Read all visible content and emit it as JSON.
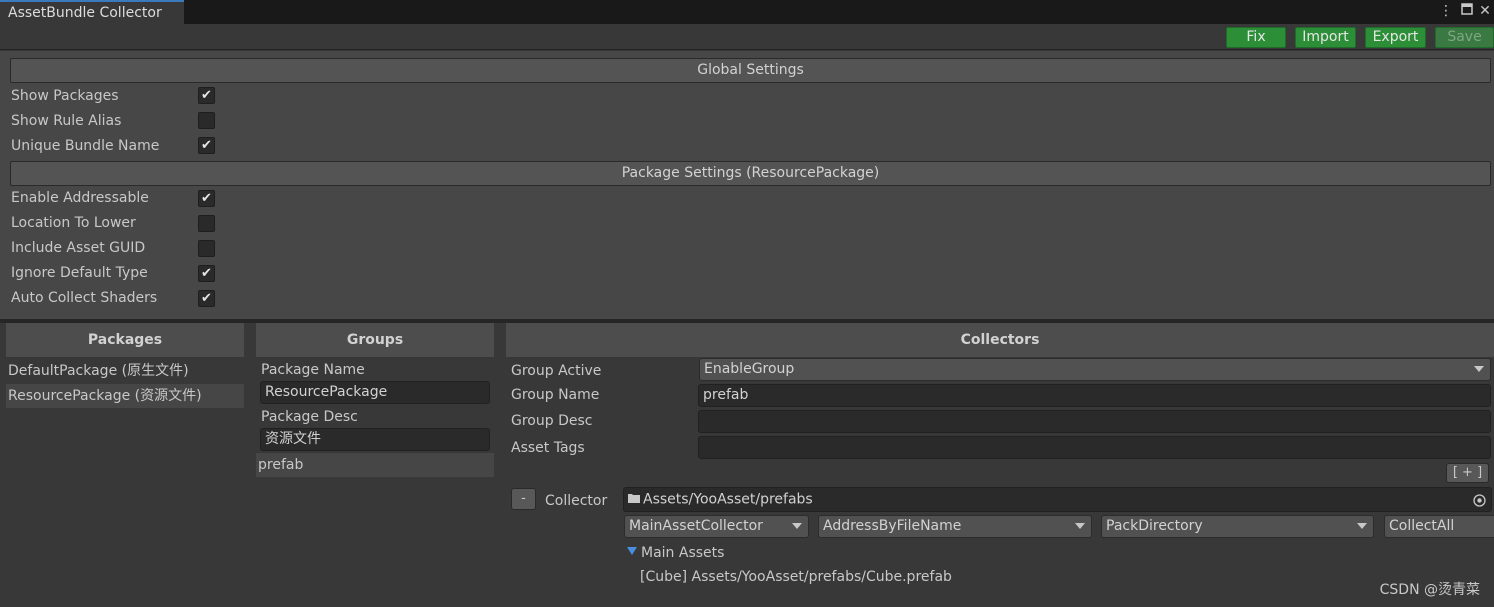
{
  "window": {
    "tab_title": "AssetBundle Collector",
    "menu_icon": "kebab-menu-icon",
    "maximize_icon": "maximize-icon",
    "close_icon": "close-icon"
  },
  "toolbar": {
    "fix": "Fix",
    "import": "Import",
    "export": "Export",
    "save": "Save"
  },
  "global_settings": {
    "header": "Global Settings",
    "options": [
      {
        "label": "Show Packages",
        "checked": true
      },
      {
        "label": "Show Rule Alias",
        "checked": false
      },
      {
        "label": "Unique Bundle Name",
        "checked": true
      }
    ]
  },
  "package_settings": {
    "header": "Package Settings (ResourcePackage)",
    "options": [
      {
        "label": "Enable Addressable",
        "checked": true
      },
      {
        "label": "Location To Lower",
        "checked": false
      },
      {
        "label": "Include Asset GUID",
        "checked": false
      },
      {
        "label": "Ignore Default Type",
        "checked": true
      },
      {
        "label": "Auto Collect Shaders",
        "checked": true
      }
    ]
  },
  "packages": {
    "header": "Packages",
    "items": [
      {
        "label": "DefaultPackage (原生文件)"
      },
      {
        "label": "ResourcePackage (资源文件)"
      }
    ]
  },
  "groups": {
    "header": "Groups",
    "package_name_label": "Package Name",
    "package_name_value": "ResourcePackage",
    "package_desc_label": "Package Desc",
    "package_desc_value": "资源文件",
    "items": [
      {
        "label": "prefab"
      }
    ]
  },
  "collectors": {
    "header": "Collectors",
    "group_active_label": "Group Active",
    "group_active_value": "EnableGroup",
    "group_name_label": "Group Name",
    "group_name_value": "prefab",
    "group_desc_label": "Group Desc",
    "group_desc_value": "",
    "asset_tags_label": "Asset Tags",
    "asset_tags_value": "",
    "add_button": "[ + ]",
    "remove_button": "-",
    "collector_label": "Collector",
    "collector_path": "Assets/YooAsset/prefabs",
    "collector_type": "MainAssetCollector",
    "address_rule": "AddressByFileName",
    "pack_rule": "PackDirectory",
    "filter_rule": "CollectAll",
    "main_assets_label": "Main Assets",
    "main_assets": [
      "[Cube] Assets/YooAsset/prefabs/Cube.prefab"
    ]
  },
  "watermark": "CSDN @烫青菜",
  "colors": {
    "accent_green": "#2c8f38",
    "tab_accent": "#3a79bb"
  }
}
